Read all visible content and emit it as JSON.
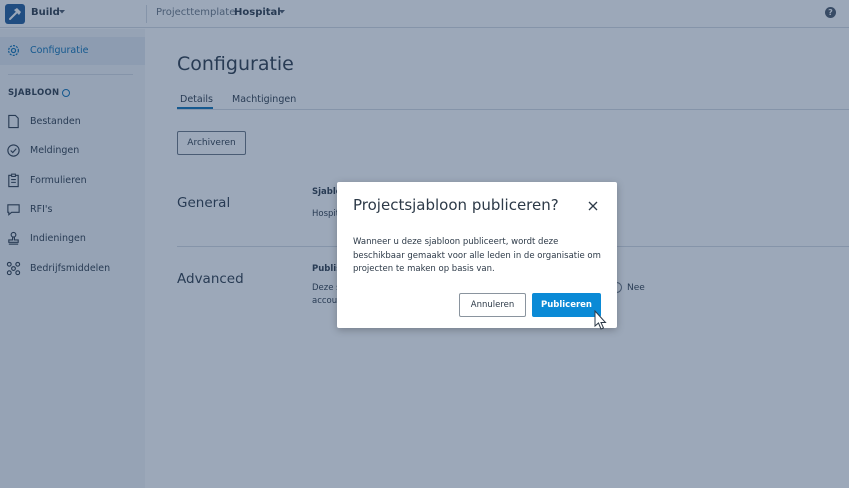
{
  "topbar": {
    "app_name": "Build",
    "breadcrumb_label": "Projecttemplate",
    "breadcrumb_value": "Hospital",
    "help_label": "?"
  },
  "sidebar": {
    "active_item": {
      "label": "Configuratie",
      "icon": "gear-icon"
    },
    "section_title": "SJABLOON",
    "items": [
      {
        "label": "Bestanden",
        "icon": "file-icon"
      },
      {
        "label": "Meldingen",
        "icon": "check-circle-icon"
      },
      {
        "label": "Formulieren",
        "icon": "clipboard-icon"
      },
      {
        "label": "RFI's",
        "icon": "chat-icon"
      },
      {
        "label": "Indieningen",
        "icon": "stamp-icon"
      },
      {
        "label": "Bedrijfsmiddelen",
        "icon": "assets-icon"
      }
    ]
  },
  "main": {
    "title": "Configuratie",
    "tabs": [
      {
        "label": "Details",
        "active": true
      },
      {
        "label": "Machtigingen",
        "active": false
      }
    ],
    "archive_button": "Archiveren",
    "sections": {
      "general": {
        "heading": "General",
        "field_label": "Sjablo",
        "field_value": "Hospit"
      },
      "advanced": {
        "heading": "Advanced",
        "field_label": "Publis",
        "desc_line1": "Deze s",
        "desc_line2": "accou",
        "radio_label": "Nee"
      }
    }
  },
  "modal": {
    "title": "Projectsjabloon publiceren?",
    "body": "Wanneer u deze sjabloon publiceert, wordt deze beschikbaar gemaakt voor alle leden in de organisatie om projecten te maken op basis van.",
    "cancel_label": "Annuleren",
    "publish_label": "Publiceren"
  },
  "colors": {
    "accent": "#0a6fb3",
    "primary_button": "#0a8ad6",
    "overlay": "#233e64",
    "logo_background": "#1e5a9a"
  }
}
